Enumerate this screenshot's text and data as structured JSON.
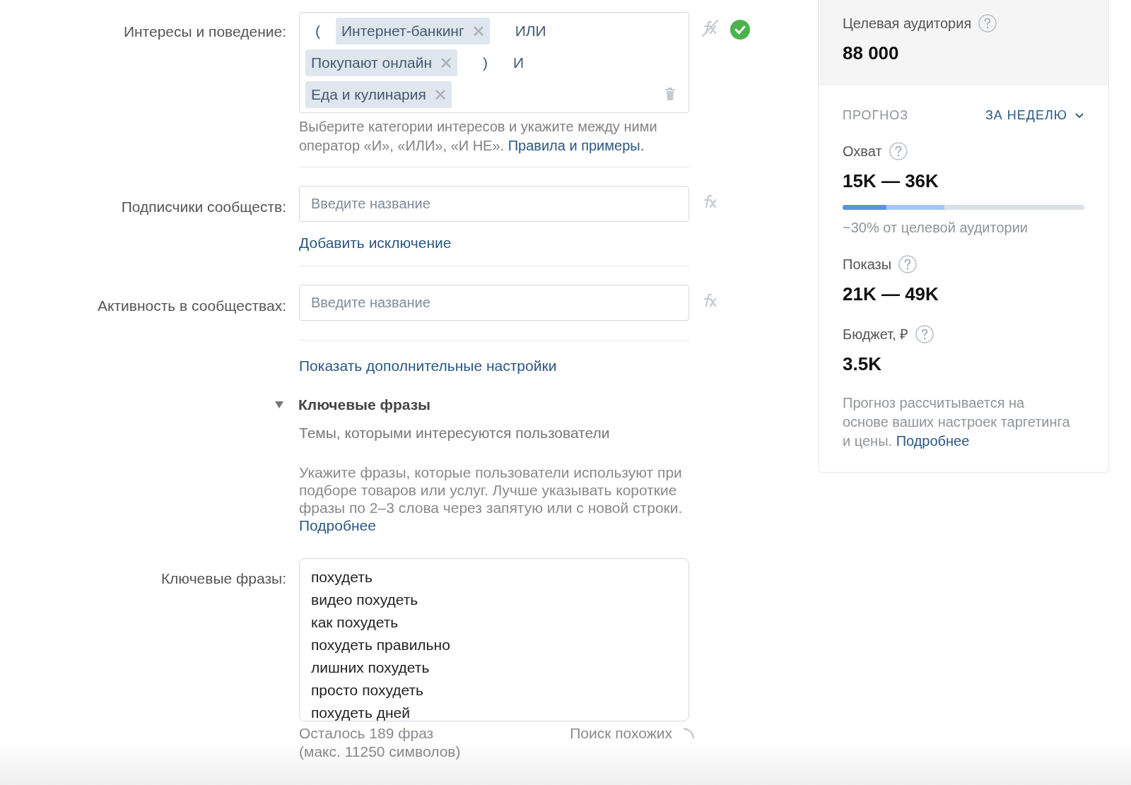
{
  "interests": {
    "label": "Интересы и поведение:",
    "tokens": [
      {
        "kind": "operator",
        "text": "("
      },
      {
        "kind": "tag",
        "text": "Интернет-банкинг"
      },
      {
        "kind": "operator",
        "text": "ИЛИ"
      },
      {
        "kind": "break"
      },
      {
        "kind": "tag",
        "text": "Покупают онлайн"
      },
      {
        "kind": "operator",
        "text": ")"
      },
      {
        "kind": "operator",
        "text": "И"
      },
      {
        "kind": "break"
      },
      {
        "kind": "tag",
        "text": "Еда и кулинария"
      }
    ],
    "valid": true,
    "hint": "Выберите категории интересов и укажите между ними оператор «И», «ИЛИ», «И НЕ».",
    "hint_link": "Правила и примеры."
  },
  "subscribers": {
    "label": "Подписчики сообществ:",
    "placeholder": "Введите название",
    "link": "Добавить исключение"
  },
  "activity": {
    "label": "Активность в сообществах:",
    "placeholder": "Введите название"
  },
  "more_settings": "Показать дополнительные настройки",
  "keywords_section": {
    "title": "Ключевые фразы",
    "expanded": true,
    "subtitle": "Темы, которыми интересуются пользователи",
    "description": "Укажите фразы, которые пользователи используют при подборе товаров или услуг. Лучше указывать короткие фразы по 2–3 слова через запятую или с новой строки.",
    "description_link": "Подробнее"
  },
  "keywords": {
    "label": "Ключевые фразы:",
    "lines": [
      "похудеть",
      "видео похудеть",
      "как похудеть",
      "похудеть правильно",
      "лишних похудеть",
      "просто похудеть",
      "похудеть дней"
    ],
    "remaining": "Осталось 189 фраз",
    "max": "(макс. 11250 символов)",
    "similar": "Поиск похожих"
  },
  "forecast_panel": {
    "audience_label": "Целевая аудитория",
    "audience_value": "88 000",
    "title": "ПРОГНОЗ",
    "period": "ЗА НЕДЕЛЮ",
    "reach_label": "Охват",
    "reach_value": "15K — 36K",
    "reach_bar": [
      {
        "level": 0.42,
        "color": "#a6c8f2"
      },
      {
        "level": 0.18,
        "color": "#5b93e0"
      }
    ],
    "reach_share": "~30% от целевой аудитории",
    "impressions_label": "Показы",
    "impressions_value": "21K — 49K",
    "budget_label": "Бюджет, ₽",
    "budget_value": "3.5K",
    "note": "Прогноз рассчитывается на основе ваших настроек таргетинга и цены.",
    "note_link": "Подробнее"
  }
}
